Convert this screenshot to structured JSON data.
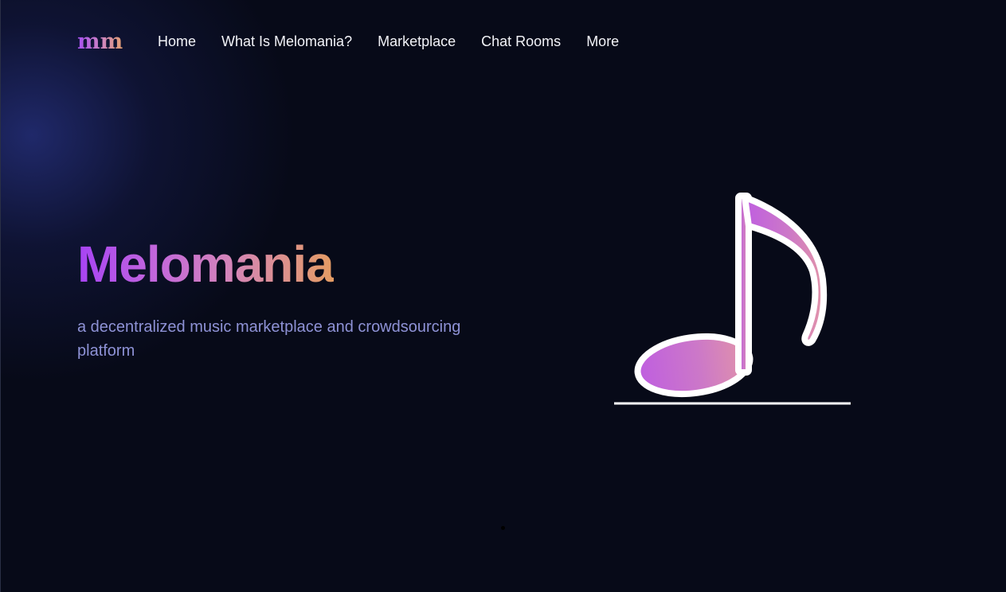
{
  "brand": {
    "logo_text": "mm"
  },
  "nav": {
    "items": [
      {
        "label": "Home"
      },
      {
        "label": "What Is Melomania?"
      },
      {
        "label": "Marketplace"
      },
      {
        "label": "Chat Rooms"
      },
      {
        "label": "More"
      }
    ]
  },
  "hero": {
    "title": "Melomania",
    "subtitle": "a decentralized music marketplace and crowdsourcing platform",
    "icon": "music-note-icon"
  },
  "colors": {
    "background": "#070a18",
    "glow": "#242e78",
    "gradient_start": "#a743f4",
    "gradient_end": "#e49c63",
    "subtitle": "#8e92d6",
    "nav_text": "#f2f3f8"
  }
}
